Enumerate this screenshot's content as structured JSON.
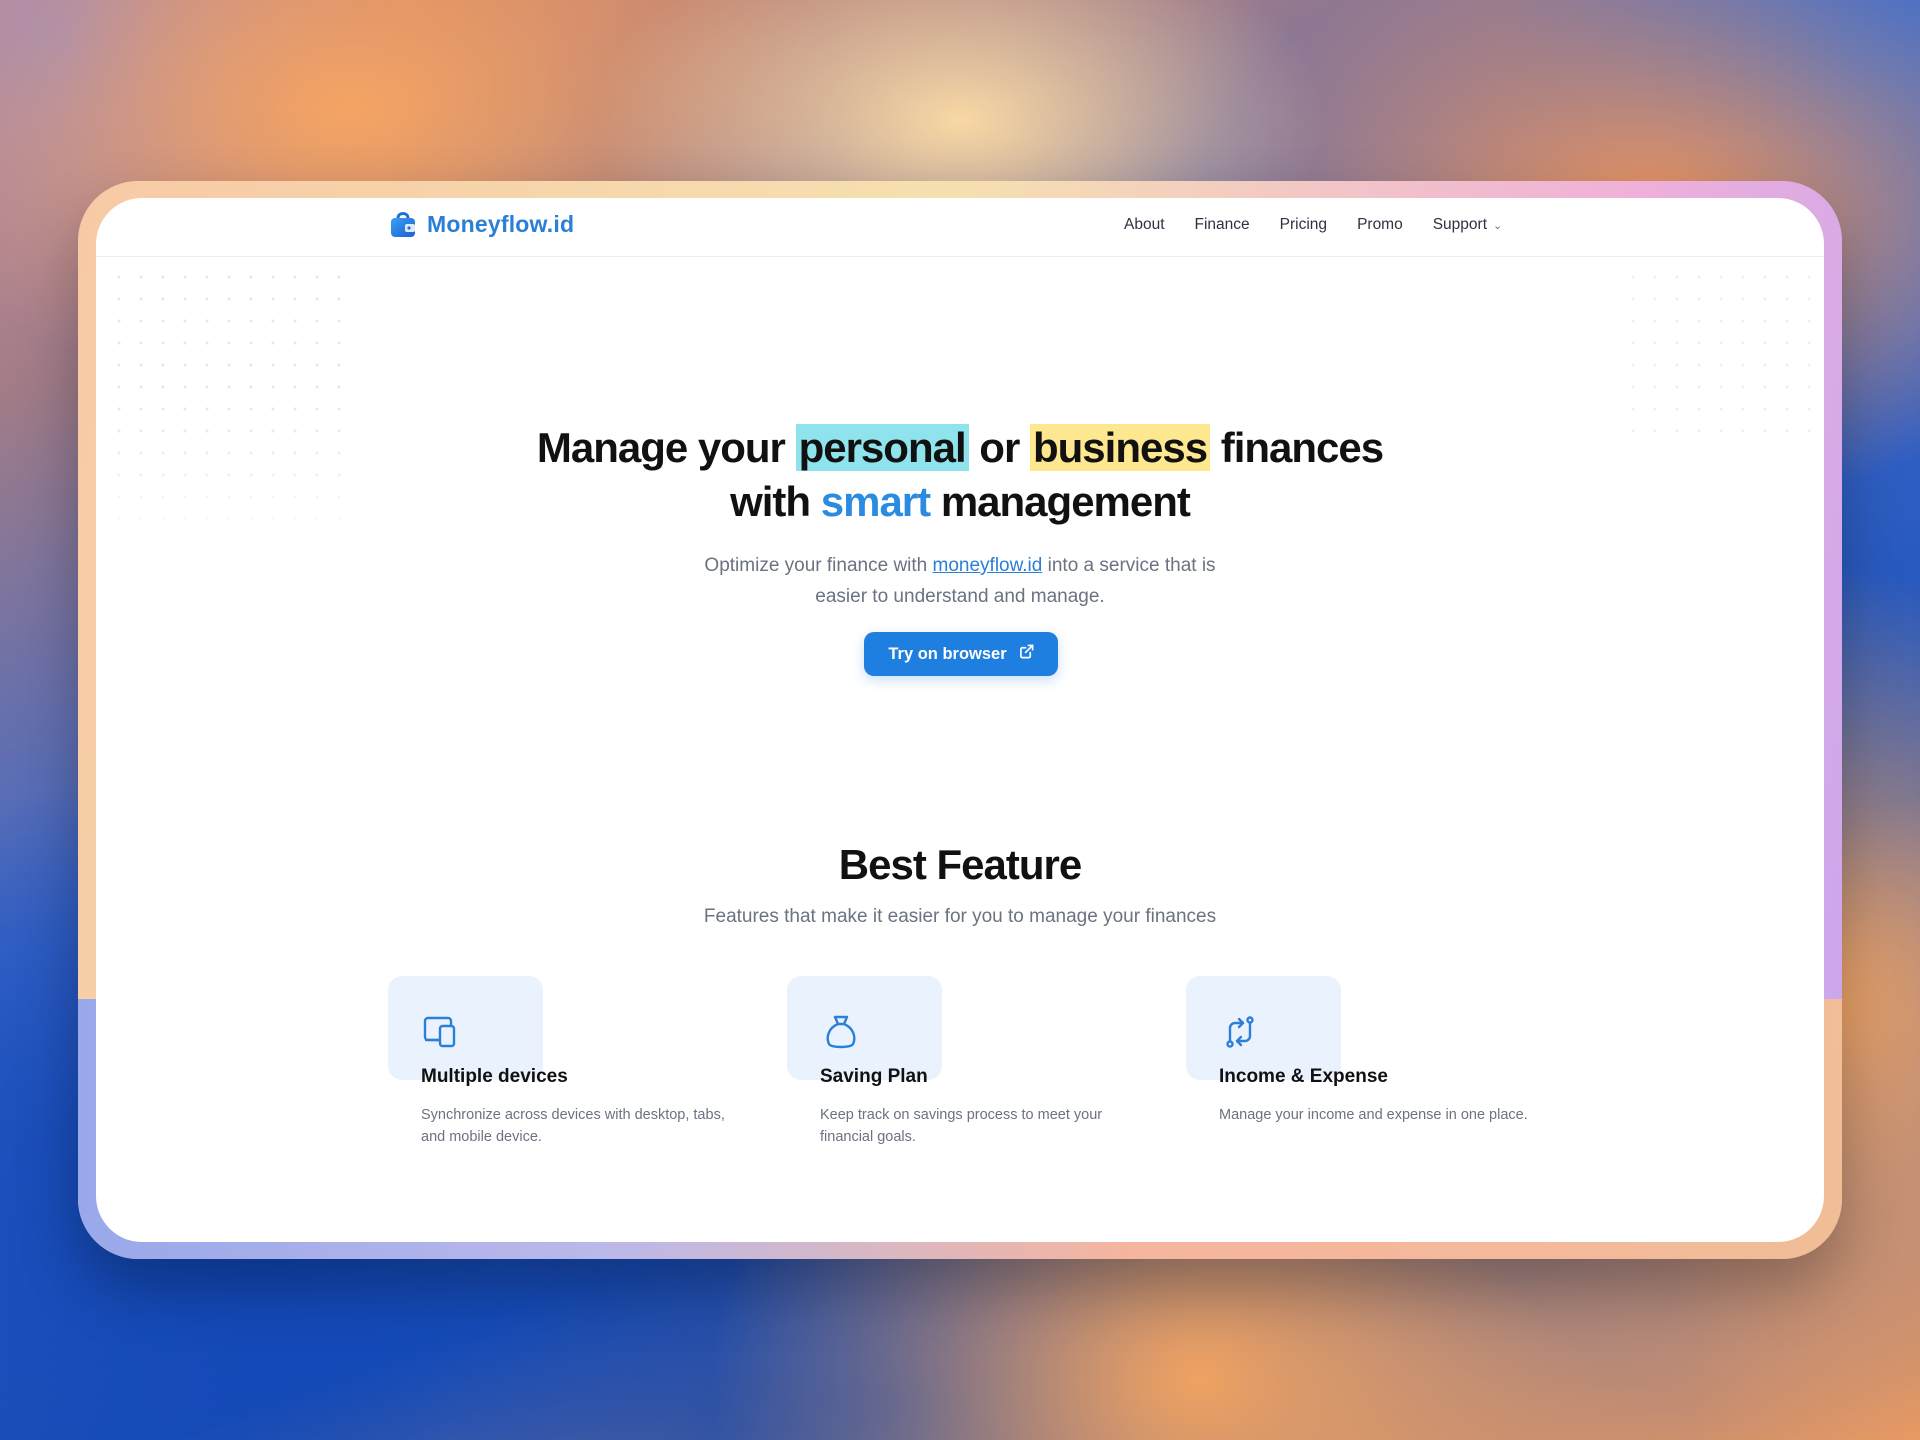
{
  "brand": {
    "name": "Moneyflow.id",
    "logo_icon": "wallet-bag-icon",
    "accent_color": "#1f7fe0"
  },
  "nav": {
    "items": [
      {
        "label": "About"
      },
      {
        "label": "Finance"
      },
      {
        "label": "Pricing"
      },
      {
        "label": "Promo"
      },
      {
        "label": "Support",
        "icon": "chevron-down-icon"
      }
    ]
  },
  "hero": {
    "title_part1": "Manage your ",
    "title_highlight1": "personal",
    "title_part2": " or ",
    "title_highlight2": "business",
    "title_part3": " finances",
    "title_line2_part1": "with ",
    "title_line2_accent": "smart",
    "title_line2_part2": " management",
    "subtitle_part1": "Optimize your finance with ",
    "subtitle_link": "moneyflow.id",
    "subtitle_part2": " into a service that is",
    "subtitle_line2": "easier to understand and manage.",
    "cta_label": "Try on browser",
    "cta_icon": "external-link-icon"
  },
  "features": {
    "title": "Best Feature",
    "subtitle": "Features that make it easier for you to manage your finances",
    "items": [
      {
        "name": "Multiple devices",
        "desc": "Synchronize across devices with desktop, tabs, and mobile device.",
        "icon": "devices-icon"
      },
      {
        "name": "Saving Plan",
        "desc": "Keep track on savings process to meet your financial goals.",
        "icon": "money-bag-icon"
      },
      {
        "name": "Income & Expense",
        "desc": "Manage your income and expense in one place.",
        "icon": "exchange-arrows-icon"
      }
    ]
  }
}
